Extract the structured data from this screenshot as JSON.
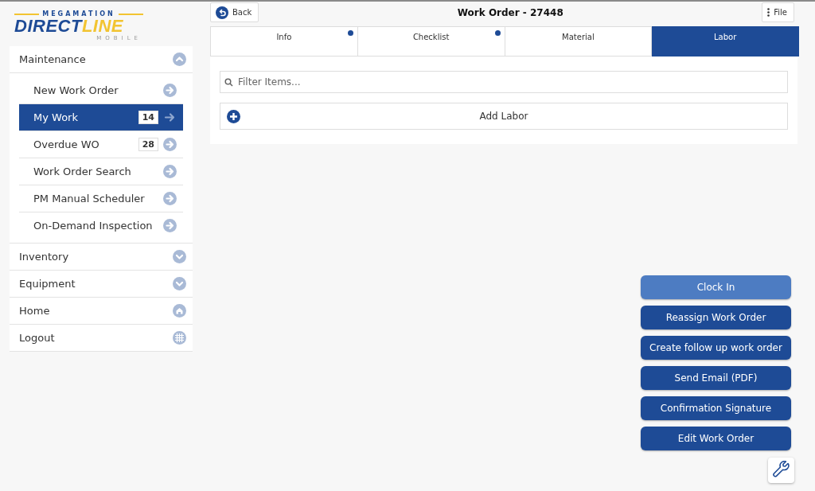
{
  "logo": {
    "top": "MEGAMATION",
    "main_left": "DIRECT",
    "main_right": "LINE",
    "sub": "MOBILE"
  },
  "sidebar": {
    "items": [
      {
        "label": "Maintenance",
        "kind": "section",
        "expanded": true,
        "children": [
          {
            "label": "New Work Order",
            "selected": false
          },
          {
            "label": "My Work",
            "selected": true,
            "count": "14"
          },
          {
            "label": "Overdue WO",
            "selected": false,
            "count": "28"
          },
          {
            "label": "Work Order Search",
            "selected": false
          },
          {
            "label": "PM Manual Scheduler",
            "selected": false
          },
          {
            "label": "On-Demand Inspection",
            "selected": false
          }
        ]
      },
      {
        "label": "Inventory",
        "kind": "section",
        "expanded": false
      },
      {
        "label": "Equipment",
        "kind": "section",
        "expanded": false
      },
      {
        "label": "Home",
        "kind": "home"
      },
      {
        "label": "Logout",
        "kind": "logout"
      }
    ]
  },
  "header": {
    "back": "Back",
    "title": "Work Order - 27448",
    "file": "File"
  },
  "tabs": [
    {
      "label": "Info",
      "selected": false,
      "flagged": true
    },
    {
      "label": "Checklist",
      "selected": false,
      "flagged": true
    },
    {
      "label": "Material",
      "selected": false,
      "flagged": false
    },
    {
      "label": "Labor",
      "selected": true,
      "flagged": false
    }
  ],
  "filter": {
    "placeholder": "Filter Items..."
  },
  "add_button": "Add Labor",
  "actions": [
    {
      "label": "Clock In",
      "kind": "light"
    },
    {
      "label": "Reassign Work Order",
      "kind": "dark"
    },
    {
      "label": "Create follow up work order",
      "kind": "dark"
    },
    {
      "label": "Send Email (PDF)",
      "kind": "dark"
    },
    {
      "label": "Confirmation Signature",
      "kind": "dark"
    },
    {
      "label": "Edit Work Order",
      "kind": "dark"
    }
  ]
}
